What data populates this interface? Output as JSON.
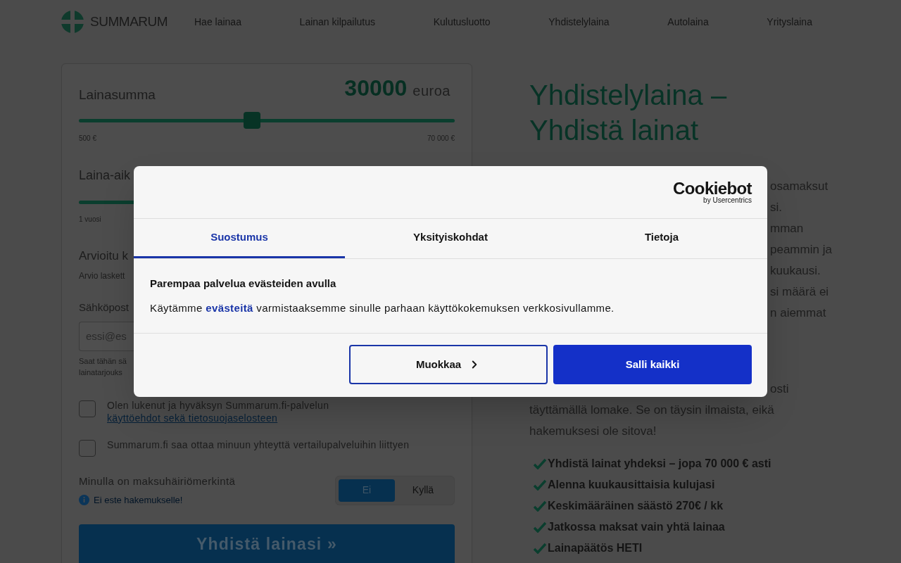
{
  "header": {
    "logo": "SUMMARUM",
    "nav": [
      {
        "label": "Hae lainaa"
      },
      {
        "label": "Lainan kilpailutus"
      },
      {
        "label": "Kulutusluotto"
      },
      {
        "label": "Yhdistelylaina"
      },
      {
        "label": "Autolaina"
      },
      {
        "label": "Yrityslaina"
      }
    ]
  },
  "form": {
    "amount": {
      "label": "Lainasumma",
      "value": "30000",
      "unit": "euroa",
      "level": 0.46,
      "min": "500 €",
      "max": "70 000 €"
    },
    "term": {
      "label": "Laina-aik",
      "min": "1 vuosi"
    },
    "estimate": {
      "label": "Arvioitu k",
      "note": "Arvio laskett"
    },
    "email": {
      "label": "Sähköpost",
      "placeholder": "essi@es",
      "help": [
        "Saat tähän sä",
        "lainatarjouks"
      ]
    },
    "consents": [
      {
        "text": "Olen lukenut ja hyväksyn Summarum.fi-palvelun ",
        "link": "käyttöehdot sekä tietosuojaselosteen",
        "checked": false
      },
      {
        "text": "Summarum.fi saa ottaa minuun yhteyttä vertailupalveluihin liittyen",
        "checked": false
      }
    ],
    "payment_default": {
      "label": "Minulla on maksuhäiriömerkintä",
      "info": "Ei este hakemukselle!",
      "options": [
        {
          "label": "Ei",
          "selected": true
        },
        {
          "label": "Kyllä",
          "selected": false
        }
      ]
    },
    "submit": "Yhdistä lainasi »"
  },
  "article": {
    "heading": [
      "Yhdistelylaina –",
      "Yhdistä lainat"
    ],
    "fragments": [
      "osamaksut",
      "si.",
      "mman",
      "peammin ja",
      "kuukausi.",
      "si määrä ei",
      "n aiemmat"
    ],
    "paragraph": [
      "osti",
      "täyttämällä lomake. Se on täysin ilmaista, eikä",
      "hakemuksesi ole sitova!"
    ],
    "benefits": [
      "Yhdistä lainat yhdeksi – jopa 70 000 € asti",
      "Alenna kuukausittaisia kulujasi",
      "Keskimääräinen säästö 270€ / kk",
      "Jatkossa maksat vain yhtä lainaa",
      "Lainapäätös HETI"
    ]
  },
  "cookie_dialog": {
    "logo": "Cookiebot",
    "logo_tagline": "by Usercentrics",
    "tabs": [
      {
        "label": "Suostumus",
        "selected": true
      },
      {
        "label": "Yksityiskohdat",
        "selected": false
      },
      {
        "label": "Tietoja",
        "selected": false
      }
    ],
    "title": "Parempaa palvelua evästeiden avulla",
    "text_before": "Käytämme ",
    "link": "evästeitä",
    "text_after": " varmistaaksemme sinulle parhaan käyttökokemuksen verkkosivullamme.",
    "buttons": [
      {
        "label": "Muokkaa",
        "kind": "secondary"
      },
      {
        "label": "Salli kaikki",
        "kind": "primary"
      }
    ]
  }
}
